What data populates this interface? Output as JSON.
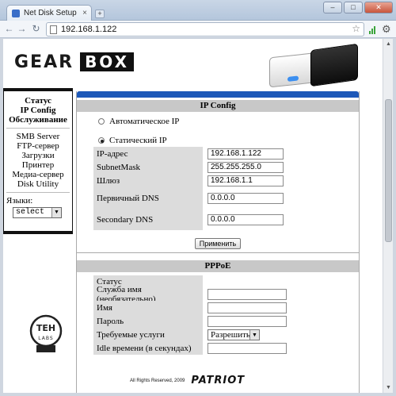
{
  "browser": {
    "tab_title": "Net Disk Setup",
    "tab_close": "×",
    "new_tab": "+",
    "url": "192.168.1.122",
    "back": "←",
    "forward": "→",
    "reload": "↻",
    "star": "☆",
    "wrench": "🔧",
    "min": "–",
    "max": "□",
    "close": "✕"
  },
  "logo": {
    "gear": "GEAR",
    "box": "BOX"
  },
  "sidebar": {
    "bold_items": [
      "Статус",
      "IP Config",
      "Обслуживание"
    ],
    "items": [
      "SMB Server",
      "FTP-сервер",
      "Загрузки",
      "Принтер",
      "Медиа-сервер",
      "Disk Utility"
    ],
    "lang_label": "Языки:",
    "lang_value": "select"
  },
  "ip_config": {
    "header": "IP Config",
    "auto_label": "Автоматическое IP",
    "static_label": "Статический IP",
    "fields": [
      {
        "label": "IP-адрес",
        "value": "192.168.1.122"
      },
      {
        "label": "SubnetMask",
        "value": "255.255.255.0"
      },
      {
        "label": "Шлюз",
        "value": "192.168.1.1"
      },
      {
        "label": "Первичный DNS",
        "value": "0.0.0.0"
      },
      {
        "label": "Secondary DNS",
        "value": "0.0.0.0"
      }
    ],
    "apply": "Применить"
  },
  "pppoe": {
    "header": "PPPoE",
    "status_label": "Статус",
    "service_label": "Служба имя (необязательно)",
    "name_label": "Имя",
    "password_label": "Пароль",
    "required_label": "Требуемые услуги",
    "required_value": "Разрешить",
    "idle_label": "Idle времени (в секундах)"
  },
  "footer": {
    "copyright": "All Rights Reserved, 2009",
    "brand": "PATRIOT"
  },
  "watermark": {
    "text1": "TEH",
    "text2": "LABS"
  },
  "colors": {
    "accent_blue": "#1d58b8",
    "header_gray": "#c8c8c8",
    "label_gray": "#dcdcdc"
  }
}
